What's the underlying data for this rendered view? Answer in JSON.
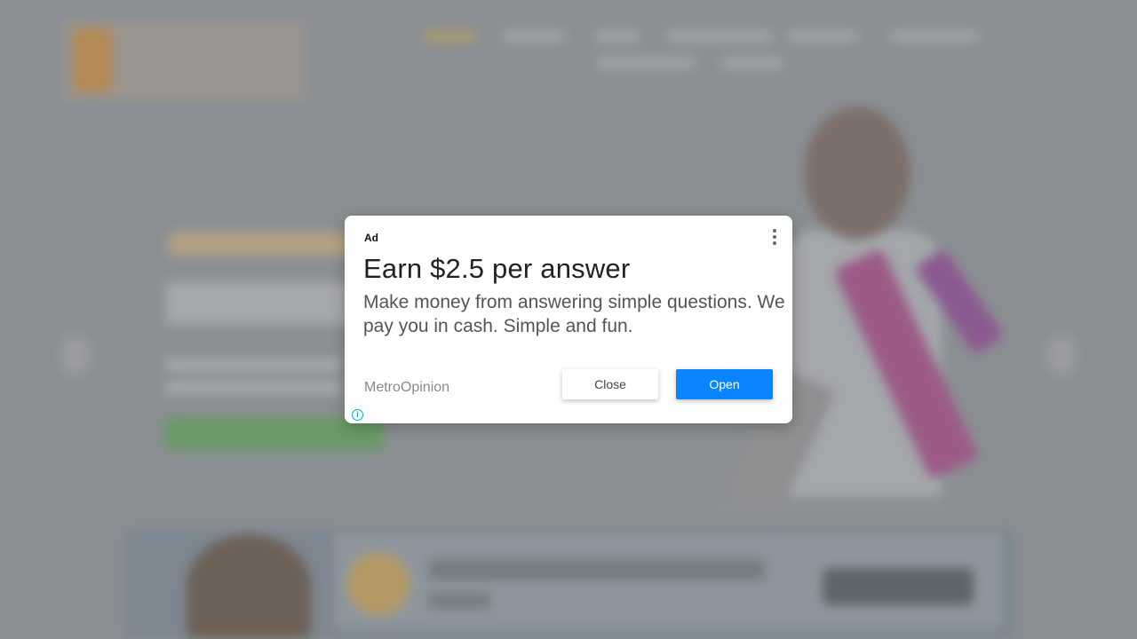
{
  "dialog": {
    "ad_label": "Ad",
    "headline": "Earn $2.5 per answer",
    "body": "Make money from answering simple questions. We pay you in cash. Simple and fun.",
    "advertiser": "MetroOpinion",
    "close_label": "Close",
    "open_label": "Open",
    "info_glyph": "i"
  },
  "colors": {
    "open_button": "#0a84ff",
    "info_icon": "#00aecd",
    "overlay": "#8b8f93"
  }
}
